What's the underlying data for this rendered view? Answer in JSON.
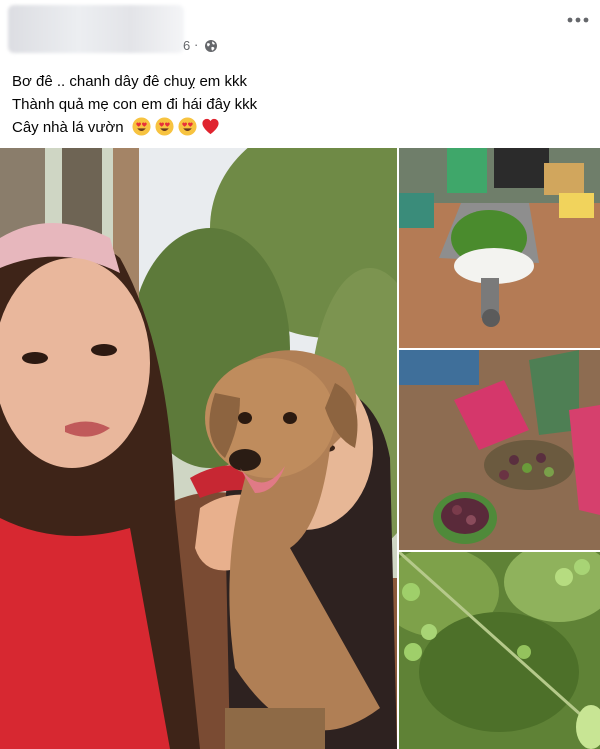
{
  "post": {
    "timestamp": "6",
    "separator": "·",
    "privacy_icon": "globe-icon",
    "more_icon": "more-horizontal-icon",
    "text_lines": [
      "Bơ đê .. chanh dây đê chuỵ em kkk",
      "Thành quả mẹ con em đi hái đây kkk",
      "Cây nhà lá vườn"
    ],
    "emojis": [
      "heart-eyes-icon",
      "heart-eyes-icon",
      "heart-eyes-icon",
      "red-heart-icon"
    ]
  },
  "colors": {
    "secondary_text": "#65676b",
    "primary_text": "#050505",
    "background": "#ffffff"
  }
}
